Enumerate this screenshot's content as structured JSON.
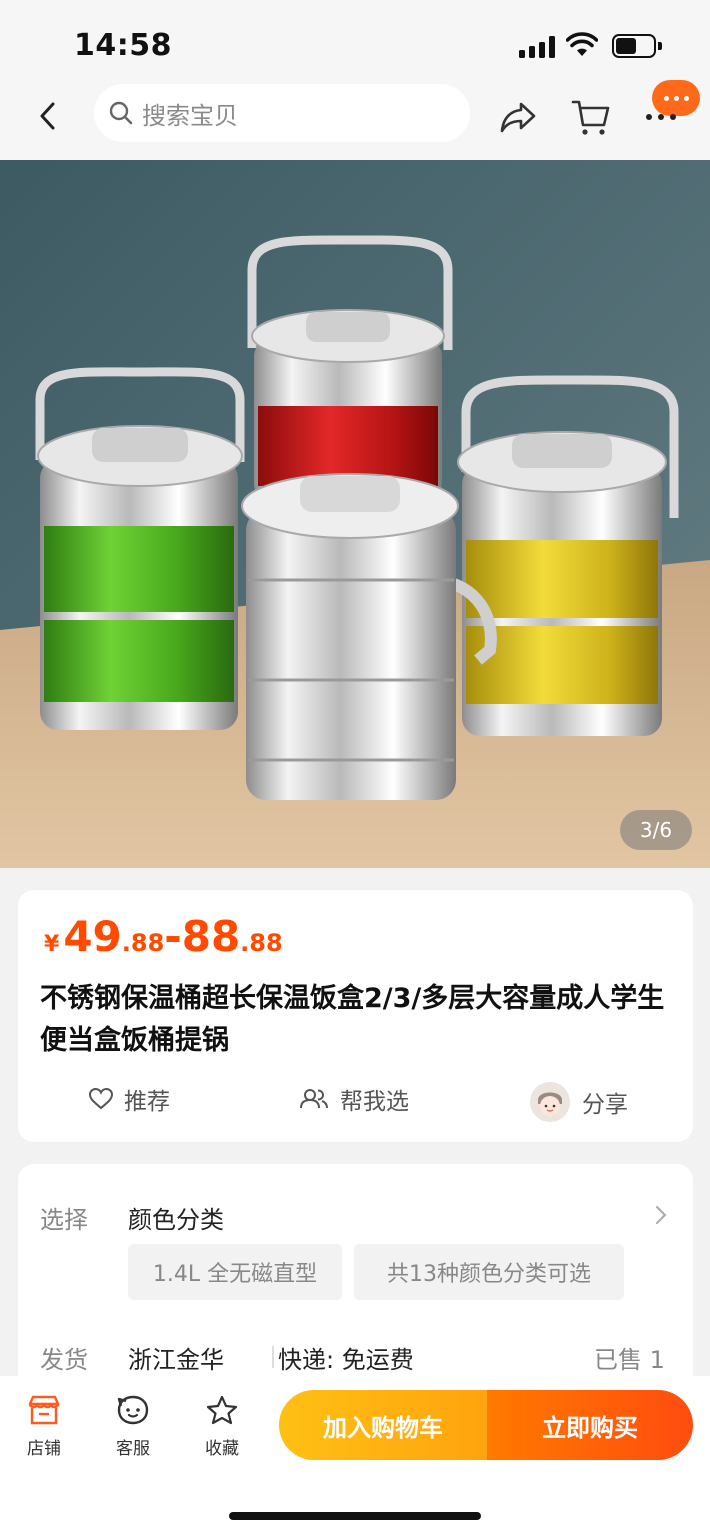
{
  "status_bar": {
    "time": "14:58",
    "battery_percent": 55
  },
  "nav": {
    "search_placeholder": "搜索宝贝",
    "icons": [
      "back-arrow-icon",
      "search-icon",
      "share-icon",
      "cart-icon",
      "more-icon"
    ],
    "accent_color": "#ff6a1a"
  },
  "product_image": {
    "counter": "3/6",
    "current_index": 3,
    "total": 6
  },
  "price": {
    "currency": "¥",
    "low_int": "49",
    "low_dec": ".88",
    "sep": "-",
    "high_int": "88",
    "high_dec": ".88",
    "color": "#ff4a00"
  },
  "product": {
    "title": "不锈钢保温桶超长保温饭盒2/3/多层大容量成人学生便当盒饭桶提锅"
  },
  "actions": {
    "recommend": "推荐",
    "help_choose": "帮我选",
    "share": "分享"
  },
  "options": {
    "select_label": "选择",
    "select_value": "颜色分类",
    "chips": [
      "1.4L 全无磁直型",
      "共13种颜色分类可选"
    ],
    "ship_label": "发货",
    "ship_origin": "浙江金华",
    "delivery": "快递: 免运费",
    "sold": "已售 1"
  },
  "bottom_bar": {
    "store": "店铺",
    "service": "客服",
    "favorite": "收藏",
    "add_to_cart": "加入购物车",
    "buy_now": "立即购买"
  }
}
